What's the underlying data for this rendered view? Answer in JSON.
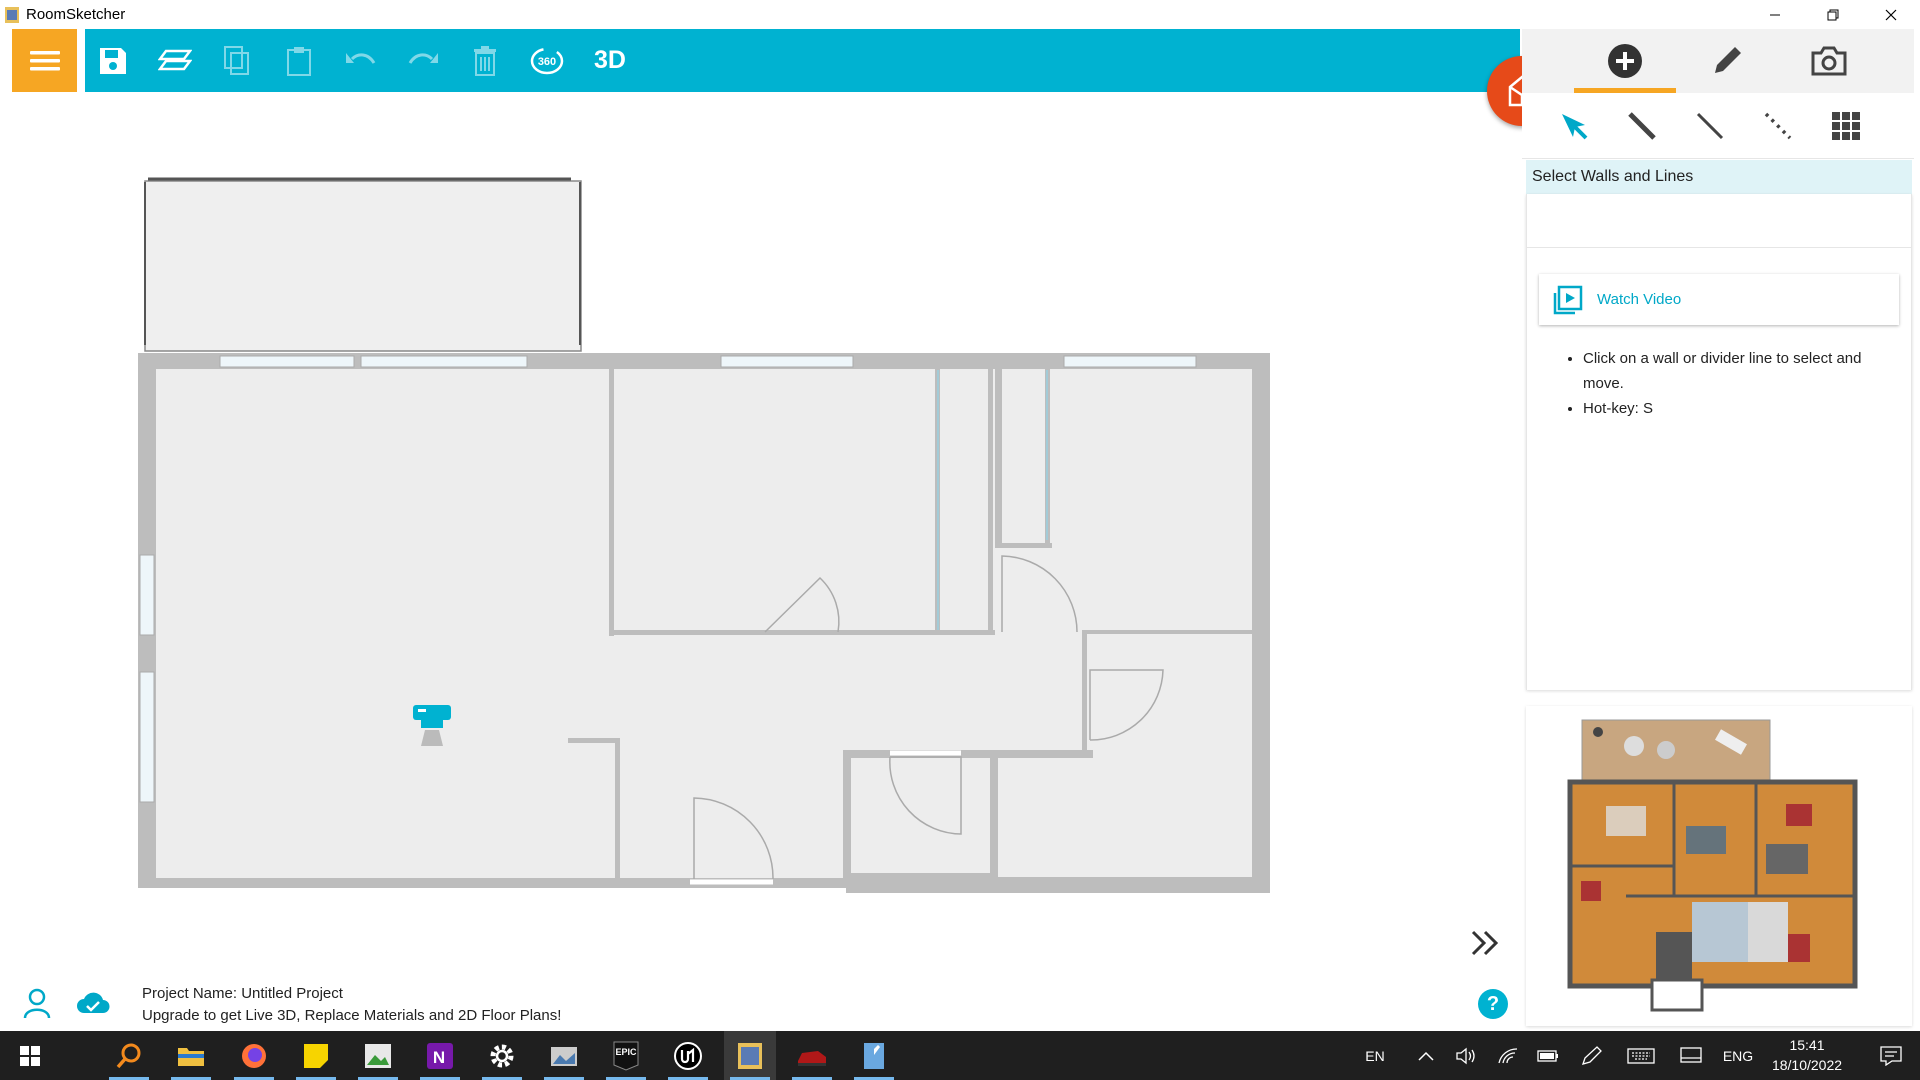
{
  "window": {
    "title": "RoomSketcher",
    "minimize_icon": "minimize-icon",
    "restore_icon": "restore-icon",
    "close_icon": "close-icon"
  },
  "toolbar": {
    "menu_icon": "hamburger-icon",
    "buttons": [
      {
        "name": "save",
        "icon": "save-icon",
        "enabled": true
      },
      {
        "name": "floors",
        "icon": "layers-icon",
        "enabled": true
      },
      {
        "name": "copy",
        "icon": "copy-icon",
        "enabled": false
      },
      {
        "name": "paste",
        "icon": "paste-icon",
        "enabled": false
      },
      {
        "name": "undo",
        "icon": "undo-icon",
        "enabled": false
      },
      {
        "name": "redo",
        "icon": "redo-icon",
        "enabled": false
      },
      {
        "name": "delete",
        "icon": "trash-icon",
        "enabled": false
      },
      {
        "name": "view-360",
        "icon": "360-icon",
        "enabled": true
      }
    ],
    "view_360_label": "360",
    "view_3d_label": "3D",
    "accent_color": "#00b2d1",
    "menu_color": "#f6a623"
  },
  "right_panel": {
    "tabs": [
      {
        "name": "add",
        "icon": "plus-circle-icon",
        "active": true
      },
      {
        "name": "edit",
        "icon": "pencil-icon",
        "active": false
      },
      {
        "name": "camera",
        "icon": "camera-icon",
        "active": false
      }
    ],
    "tools": [
      {
        "name": "select",
        "icon": "cursor-icon",
        "active": true
      },
      {
        "name": "wall",
        "icon": "wall-line-icon",
        "active": false
      },
      {
        "name": "line",
        "icon": "line-icon",
        "active": false
      },
      {
        "name": "dashed-line",
        "icon": "dashed-line-icon",
        "active": false
      },
      {
        "name": "grid",
        "icon": "grid-icon",
        "active": false
      }
    ],
    "hint": "Select Walls and Lines",
    "watch_video": "Watch Video",
    "bullets": [
      "Click on a wall or divider line to select and move.",
      "Hot-key: S"
    ]
  },
  "status": {
    "project_name": "Project Name: Untitled Project",
    "upgrade": "Upgrade to get Live 3D, Replace Materials and 2D Floor Plans!",
    "help": "?"
  },
  "taskbar": {
    "apps": [
      {
        "name": "search",
        "icon": "search-icon"
      },
      {
        "name": "file-explorer",
        "icon": "folder-icon"
      },
      {
        "name": "firefox",
        "icon": "firefox-icon"
      },
      {
        "name": "sticky-notes",
        "icon": "sticky-notes-icon"
      },
      {
        "name": "image-app",
        "icon": "image-icon"
      },
      {
        "name": "onenote",
        "icon": "onenote-icon"
      },
      {
        "name": "settings",
        "icon": "gear-icon"
      },
      {
        "name": "photos",
        "icon": "photos-icon"
      },
      {
        "name": "epic-games",
        "icon": "epic-games-icon"
      },
      {
        "name": "unreal-engine",
        "icon": "unreal-icon"
      },
      {
        "name": "roomsketcher",
        "icon": "roomsketcher-icon"
      },
      {
        "name": "car-game",
        "icon": "car-icon"
      },
      {
        "name": "notepad",
        "icon": "notepad-icon"
      }
    ],
    "epic_label": "EPIC",
    "lang_short": "EN",
    "lang_long": "ENG",
    "time": "15:41",
    "date": "18/10/2022"
  }
}
